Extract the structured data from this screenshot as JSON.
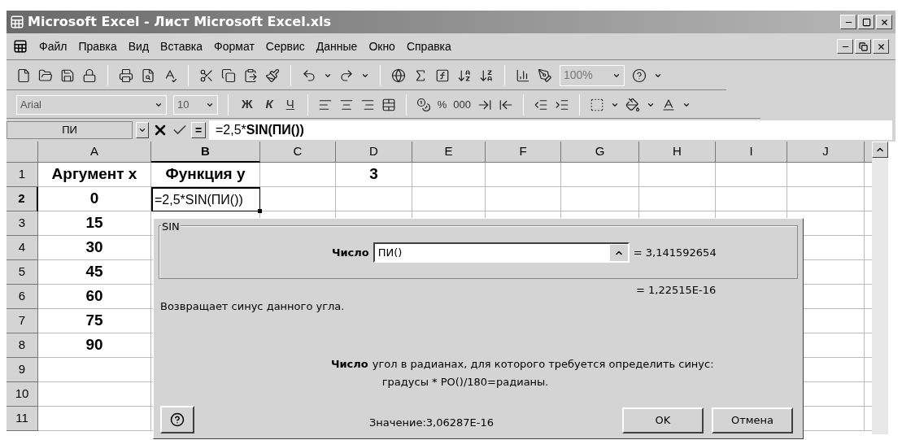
{
  "window": {
    "title": "Microsoft Excel - Лист Microsoft Excel.xls"
  },
  "menu": [
    "Файл",
    "Правка",
    "Вид",
    "Вставка",
    "Формат",
    "Сервис",
    "Данные",
    "Окно",
    "Справка"
  ],
  "standard_toolbar": {
    "zoom": "100%"
  },
  "formatting_toolbar": {
    "font": "Arial",
    "size": "10",
    "style_buttons": [
      "Ж",
      "К",
      "Ч"
    ],
    "number_buttons": [
      "%",
      "000"
    ]
  },
  "formula_bar": {
    "name_box": "ПИ",
    "equals": "=",
    "formula_parts": [
      {
        "text": "=2,5*",
        "bold": false
      },
      {
        "text": "SIN(ПИ())",
        "bold": true
      }
    ]
  },
  "sheet": {
    "columns": [
      {
        "label": "A",
        "selected": false
      },
      {
        "label": "B",
        "selected": true
      },
      {
        "label": "C",
        "selected": false
      },
      {
        "label": "D",
        "selected": false
      },
      {
        "label": "E",
        "selected": false
      },
      {
        "label": "F",
        "selected": false
      },
      {
        "label": "G",
        "selected": false
      },
      {
        "label": "H",
        "selected": false
      },
      {
        "label": "I",
        "selected": false
      },
      {
        "label": "J",
        "selected": false
      }
    ],
    "rows": [
      {
        "label": "1",
        "selected": false,
        "cells": {
          "A": "Аргумент x",
          "B": "Функция y",
          "D": "3"
        }
      },
      {
        "label": "2",
        "selected": true,
        "cells": {
          "A": "0",
          "B": "=2,5*SIN(ПИ())"
        }
      },
      {
        "label": "3",
        "selected": false,
        "cells": {
          "A": "15"
        }
      },
      {
        "label": "4",
        "selected": false,
        "cells": {
          "A": "30"
        }
      },
      {
        "label": "5",
        "selected": false,
        "cells": {
          "A": "45"
        }
      },
      {
        "label": "6",
        "selected": false,
        "cells": {
          "A": "60"
        }
      },
      {
        "label": "7",
        "selected": false,
        "cells": {
          "A": "75"
        }
      },
      {
        "label": "8",
        "selected": false,
        "cells": {
          "A": "90"
        }
      },
      {
        "label": "9",
        "selected": false,
        "cells": {}
      },
      {
        "label": "10",
        "selected": false,
        "cells": {}
      },
      {
        "label": "11",
        "selected": false,
        "cells": {}
      }
    ]
  },
  "dialog": {
    "group": "SIN",
    "argument_label": "Число",
    "argument_value": "ПИ()",
    "argument_result": "= 3,141592654",
    "function_result": "= 1,22515E-16",
    "description": "Возвращает синус данного угла.",
    "help_label": "Число",
    "help_lines": [
      "угол в радианах, для которого требуется определить синус:",
      "градусы * PO()/180=радианы."
    ],
    "value": "Значение:3,06287E-16",
    "buttons": [
      "OK",
      "Отмена"
    ]
  }
}
